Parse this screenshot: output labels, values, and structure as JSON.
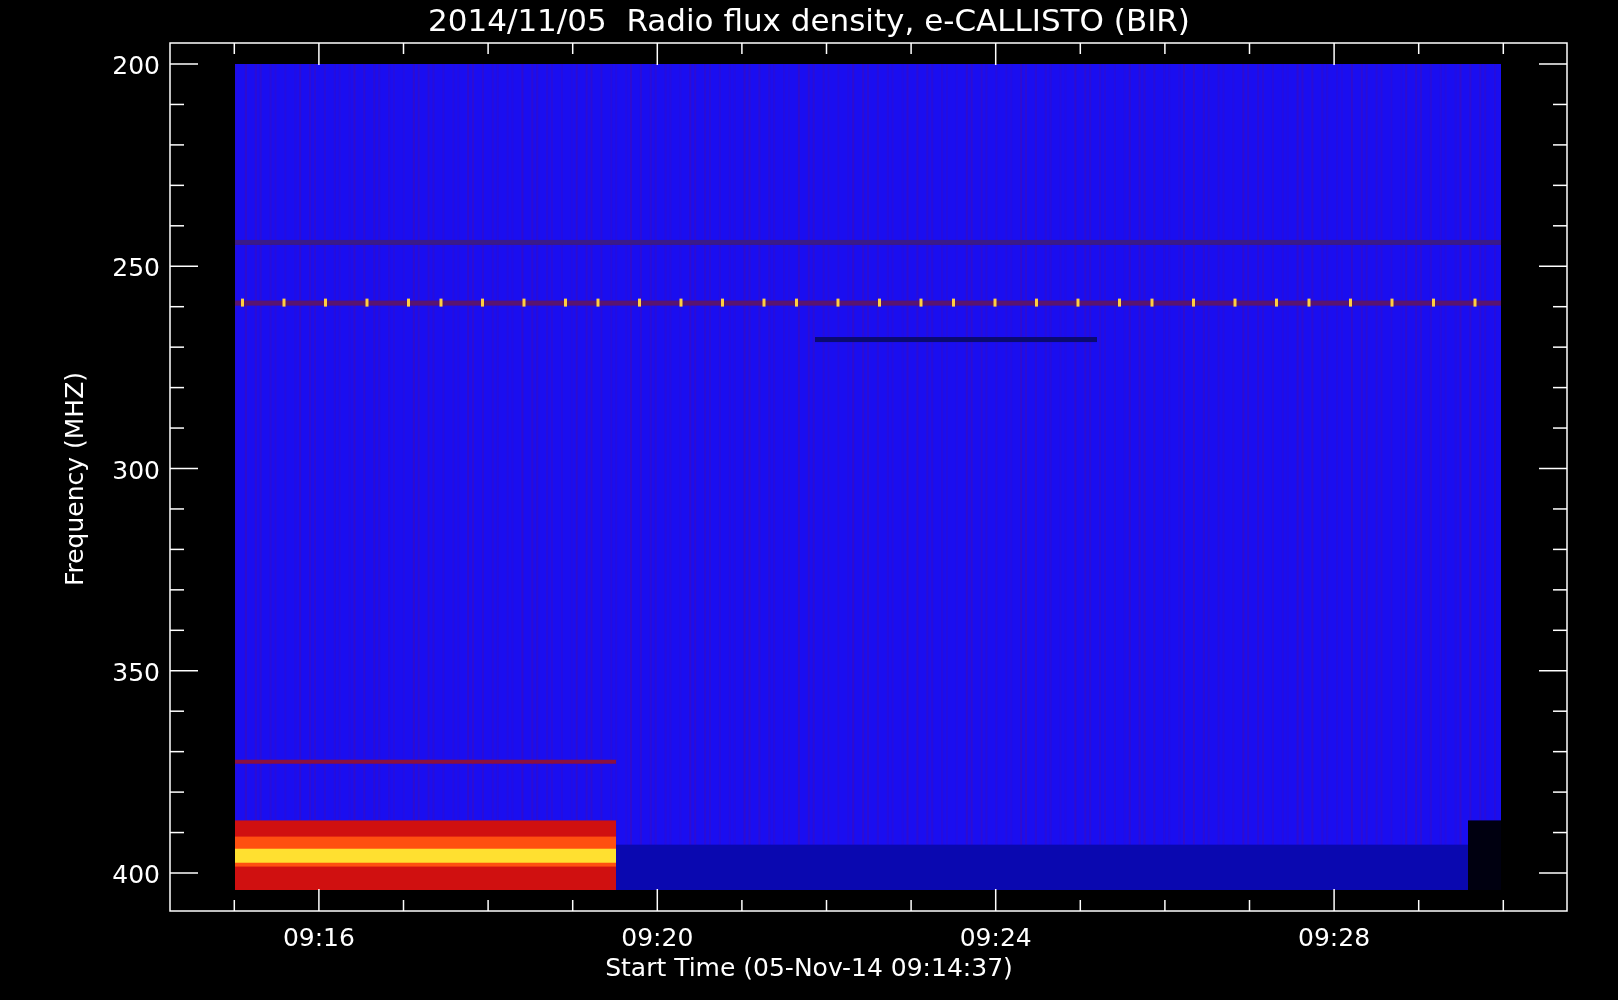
{
  "chart": {
    "title": "2014/11/05  Radio flux density, e-CALLISTO (BIR)",
    "y_axis": {
      "label": "Frequency (MHZ)",
      "ticks": [
        "200",
        "250",
        "300",
        "350",
        "400"
      ]
    },
    "x_axis": {
      "label": "Start Time (05-Nov-14 09:14:37)",
      "ticks": [
        "09:16",
        "09:20",
        "09:24",
        "09:28"
      ]
    }
  }
}
